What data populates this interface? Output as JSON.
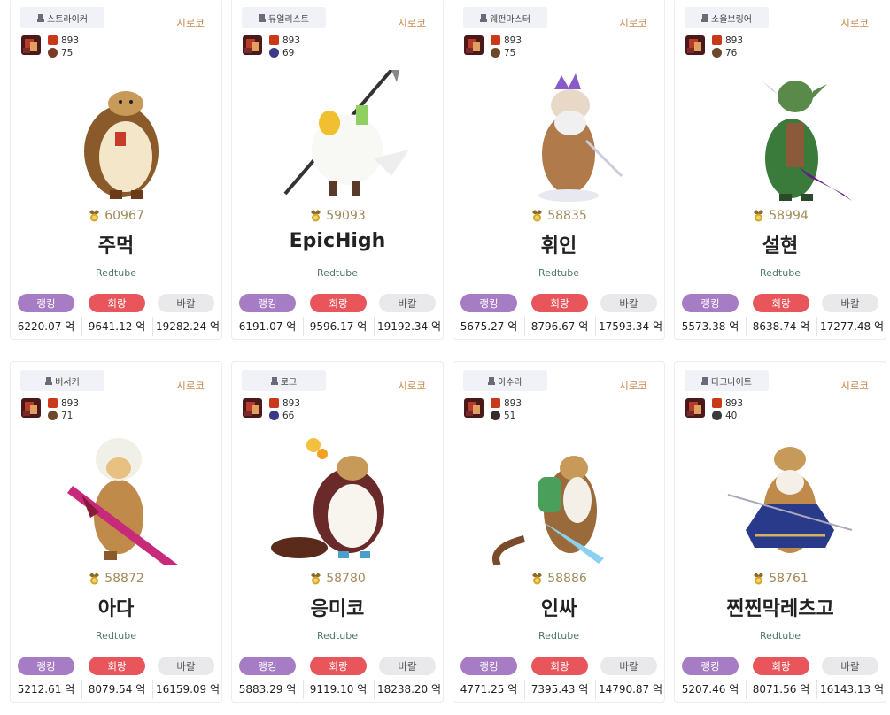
{
  "colors": {
    "server": "#c9854a",
    "rank_pill": "#a67cc4",
    "damage_pill": "#e8555a",
    "buff_pill": "#e9e9eb",
    "guild": "#4e7a6a",
    "fame": "#a08a5a"
  },
  "cards": [
    {
      "job": "스트라이커",
      "server": "시로코",
      "stat1": "893",
      "stat2": "75",
      "fame": "60967",
      "name": "주먹",
      "guild": "Redtube",
      "labels": [
        "랭킹",
        "회랑",
        "바칼"
      ],
      "values": [
        "6220.07 억",
        "9641.12 억",
        "19282.24 억"
      ],
      "art": "hedgehog",
      "icon2": "#7a3a2a"
    },
    {
      "job": "듀얼리스트",
      "server": "시로코",
      "stat1": "893",
      "stat2": "69",
      "fame": "59093",
      "name": "EpicHigh",
      "guild": "Redtube",
      "labels": [
        "랭킹",
        "회랑",
        "바칼"
      ],
      "values": [
        "6191.07 억",
        "9596.17 억",
        "19192.34 억"
      ],
      "art": "bird",
      "icon2": "#3a3a8a"
    },
    {
      "job": "웨펀마스터",
      "server": "시로코",
      "stat1": "893",
      "stat2": "75",
      "fame": "58835",
      "name": "휘인",
      "guild": "Redtube",
      "labels": [
        "랭킹",
        "회랑",
        "바칼"
      ],
      "values": [
        "5675.27 억",
        "8796.67 억",
        "17593.34 억"
      ],
      "art": "oldman",
      "icon2": "#6a4a2a"
    },
    {
      "job": "소울브링어",
      "server": "시로코",
      "stat1": "893",
      "stat2": "76",
      "fame": "58994",
      "name": "설현",
      "guild": "Redtube",
      "labels": [
        "랭킹",
        "회랑",
        "바칼"
      ],
      "values": [
        "5573.38 억",
        "8638.74 억",
        "17277.48 억"
      ],
      "art": "goblin",
      "icon2": "#6a4a2a"
    },
    {
      "job": "버서커",
      "server": "시로코",
      "stat1": "893",
      "stat2": "71",
      "fame": "58872",
      "name": "아다",
      "guild": "Redtube",
      "labels": [
        "랭킹",
        "회랑",
        "바칼"
      ],
      "values": [
        "5212.61 억",
        "8079.54 억",
        "16159.09 억"
      ],
      "art": "berserker",
      "icon2": "#6a4a2a"
    },
    {
      "job": "로그",
      "server": "시로코",
      "stat1": "893",
      "stat2": "66",
      "fame": "58780",
      "name": "응미코",
      "guild": "Redtube",
      "labels": [
        "랭킹",
        "회랑",
        "바칼"
      ],
      "values": [
        "5883.29 억",
        "9119.10 억",
        "18238.20 억"
      ],
      "art": "raccoon",
      "icon2": "#3a3a8a"
    },
    {
      "job": "아수라",
      "server": "시로코",
      "stat1": "893",
      "stat2": "51",
      "fame": "58886",
      "name": "인싸",
      "guild": "Redtube",
      "labels": [
        "랭킹",
        "회랑",
        "바칼"
      ],
      "values": [
        "4771.25 억",
        "7395.43 억",
        "14790.87 억"
      ],
      "art": "monkey",
      "icon2": "#3a2a2a"
    },
    {
      "job": "다크나이트",
      "server": "시로코",
      "stat1": "893",
      "stat2": "40",
      "fame": "58761",
      "name": "찐찐막레츠고",
      "guild": "Redtube",
      "labels": [
        "랭킹",
        "회랑",
        "바칼"
      ],
      "values": [
        "5207.46 억",
        "8071.56 억",
        "16143.13 억"
      ],
      "art": "cloaked",
      "icon2": "#3a3a3a"
    }
  ]
}
